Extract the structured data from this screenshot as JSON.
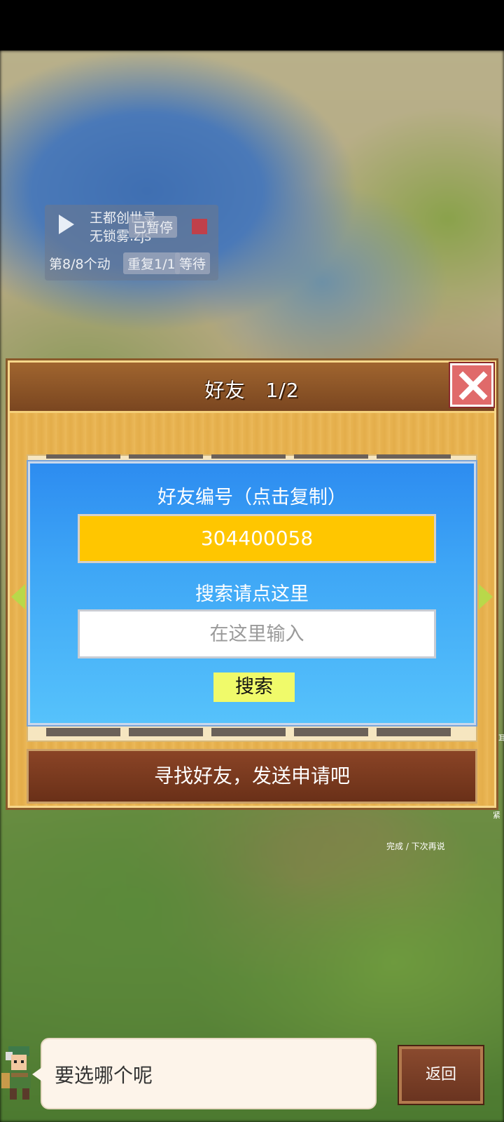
{
  "macro": {
    "script_name_line1": "王都创世录",
    "script_name_line2": "无锁雾.zjs",
    "status": "已暂停",
    "step_progress": "第8/8个动",
    "repeat": "重复1/1",
    "wait": "等待"
  },
  "dialog": {
    "title": "好友　1/2",
    "friend_id_label": "好友编号（点击复制）",
    "friend_id": "304400058",
    "search_label": "搜索请点这里",
    "search_placeholder": "在这里输入",
    "search_button": "搜索",
    "find_friends_button": "寻找好友，发送申请吧"
  },
  "hint": "完成 / 下次再说",
  "edge_text_1": "耳",
  "edge_text_2": "紧",
  "bottom": {
    "speech": "要选哪个呢",
    "back_button": "返回"
  },
  "colors": {
    "panel_blue": "#2d8cf0",
    "id_box": "#ffc600",
    "search_button": "#f0fa6a",
    "close_button": "#e06a6a"
  }
}
